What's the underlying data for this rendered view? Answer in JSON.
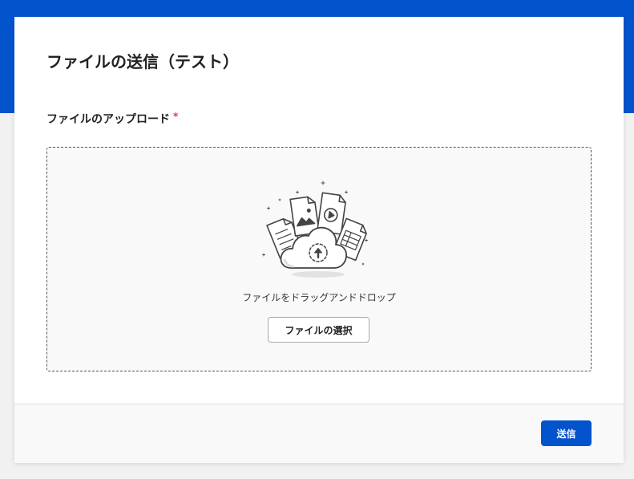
{
  "form": {
    "title": "ファイルの送信（テスト）",
    "field_label": "ファイルのアップロード",
    "required_mark": "*"
  },
  "drop_zone": {
    "illustration_icon": "cloud-upload-files-icon",
    "instruction": "ファイルをドラッグアンドドロップ",
    "select_button_label": "ファイルの選択"
  },
  "footer": {
    "submit_label": "送信"
  },
  "colors": {
    "brand": "#0353cc",
    "required": "#e5353b",
    "page_background": "#f1f1f1",
    "drop_zone_background": "#f9f9f9"
  }
}
